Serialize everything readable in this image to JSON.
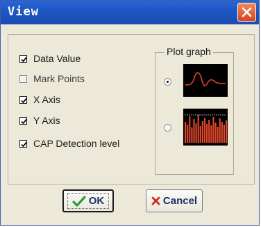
{
  "window": {
    "title": "View"
  },
  "options": [
    {
      "label": "Data Value",
      "checked": true
    },
    {
      "label": "Mark Points",
      "checked": false
    },
    {
      "label": "X Axis",
      "checked": true
    },
    {
      "label": "Y Axis",
      "checked": true
    },
    {
      "label": "CAP Detection level",
      "checked": true
    }
  ],
  "plot_graph": {
    "title": "Plot graph",
    "choices": [
      {
        "name": "line-waveform",
        "selected": true
      },
      {
        "name": "bar-histogram",
        "selected": false
      }
    ]
  },
  "buttons": {
    "ok_label": "OK",
    "cancel_label": "Cancel"
  },
  "colors": {
    "titlebar": "#1f57c4",
    "close": "#d8431f",
    "plot_signal": "#e2452a",
    "ok_check": "#2e9a33",
    "cancel_x": "#d62a1e"
  },
  "icons": {
    "close": "close-icon",
    "ok": "checkmark-icon",
    "cancel": "x-icon"
  }
}
